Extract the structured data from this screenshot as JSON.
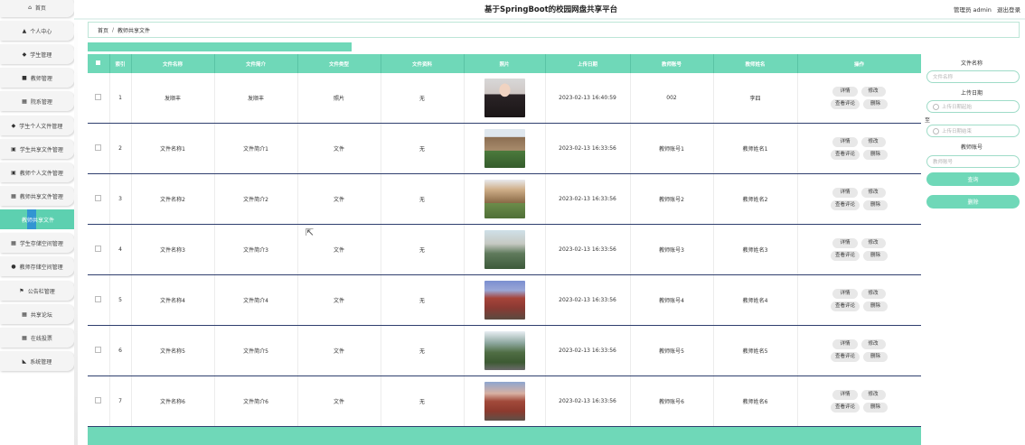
{
  "app": {
    "title": "基于SpringBoot的校园网盘共享平台",
    "user_label": "管理员 admin",
    "logout": "退出登录"
  },
  "sidebar": {
    "items": [
      {
        "label": "首页",
        "icon": "home-icon",
        "glyph": "⌂"
      },
      {
        "label": "个人中心",
        "icon": "user-icon",
        "glyph": "▲"
      },
      {
        "label": "学生管理",
        "icon": "student-icon",
        "glyph": "◆"
      },
      {
        "label": "教师管理",
        "icon": "teacher-icon",
        "glyph": "■"
      },
      {
        "label": "院系管理",
        "icon": "grid-icon",
        "glyph": "▦"
      },
      {
        "label": "学生个人文件管理",
        "icon": "folder-icon",
        "glyph": "◆"
      },
      {
        "label": "学生共享文件管理",
        "icon": "doc-icon",
        "glyph": "▣"
      },
      {
        "label": "教师个人文件管理",
        "icon": "doc-icon",
        "glyph": "▣"
      },
      {
        "label": "教师共享文件管理",
        "icon": "grid-icon",
        "glyph": "▦"
      },
      {
        "label": "教师共享文件",
        "icon": "",
        "glyph": ""
      },
      {
        "label": "学生存储空间管理",
        "icon": "grid-icon",
        "glyph": "▦"
      },
      {
        "label": "教师存储空间管理",
        "icon": "pin-icon",
        "glyph": "●"
      },
      {
        "label": "公告栏管理",
        "icon": "flag-icon",
        "glyph": "⚑"
      },
      {
        "label": "共享论坛",
        "icon": "grid-icon",
        "glyph": "▦"
      },
      {
        "label": "在线投票",
        "icon": "grid-icon",
        "glyph": "▦"
      },
      {
        "label": "系统管理",
        "icon": "settings-icon",
        "glyph": "◣"
      }
    ]
  },
  "breadcrumb": {
    "home": "首页",
    "sep": "/",
    "current": "教师共享文件"
  },
  "table": {
    "headers": [
      "",
      "索引",
      "文件名称",
      "文件简介",
      "文件类型",
      "文件资料",
      "照片",
      "上传日期",
      "教师账号",
      "教师姓名",
      "操作"
    ],
    "rows": [
      {
        "index": "1",
        "name": "发顺丰",
        "intro": "发顺丰",
        "type": "照片",
        "material": "无",
        "date": "2023-02-13 16:40:59",
        "account": "002",
        "teacher": "李四",
        "photo": "portrait"
      },
      {
        "index": "2",
        "name": "文件名称1",
        "intro": "文件简介1",
        "type": "文件",
        "material": "无",
        "date": "2023-02-13 16:33:56",
        "account": "教师账号1",
        "teacher": "教师姓名1",
        "photo": "campus1"
      },
      {
        "index": "3",
        "name": "文件名称2",
        "intro": "文件简介2",
        "type": "文件",
        "material": "无",
        "date": "2023-02-13 16:33:56",
        "account": "教师账号2",
        "teacher": "教师姓名2",
        "photo": "campus2"
      },
      {
        "index": "4",
        "name": "文件名称3",
        "intro": "文件简介3",
        "type": "文件",
        "material": "无",
        "date": "2023-02-13 16:33:56",
        "account": "教师账号3",
        "teacher": "教师姓名3",
        "photo": "campus3"
      },
      {
        "index": "5",
        "name": "文件名称4",
        "intro": "文件简介4",
        "type": "文件",
        "material": "无",
        "date": "2023-02-13 16:33:56",
        "account": "教师账号4",
        "teacher": "教师姓名4",
        "photo": "campus4"
      },
      {
        "index": "6",
        "name": "文件名称5",
        "intro": "文件简介5",
        "type": "文件",
        "material": "无",
        "date": "2023-02-13 16:33:56",
        "account": "教师账号5",
        "teacher": "教师姓名5",
        "photo": "campus5"
      },
      {
        "index": "7",
        "name": "文件名称6",
        "intro": "文件简介6",
        "type": "文件",
        "material": "无",
        "date": "2023-02-13 16:33:56",
        "account": "教师账号6",
        "teacher": "教师姓名6",
        "photo": "campus6"
      }
    ],
    "actions": {
      "detail": "详情",
      "edit": "修改",
      "review": "查看评论",
      "delete": "删除"
    }
  },
  "search": {
    "file_name_label": "文件名称",
    "file_name_placeholder": "文件名称",
    "upload_date_label": "上传日期",
    "date_start_placeholder": "上传日期起始",
    "to_label": "至",
    "date_end_placeholder": "上传日期结束",
    "account_label": "教师账号",
    "account_placeholder": "教师账号",
    "query_button": "查询",
    "delete_button": "删除"
  },
  "colors": {
    "accent": "#6fd8b8",
    "active_nav": "#5dd0b0"
  }
}
